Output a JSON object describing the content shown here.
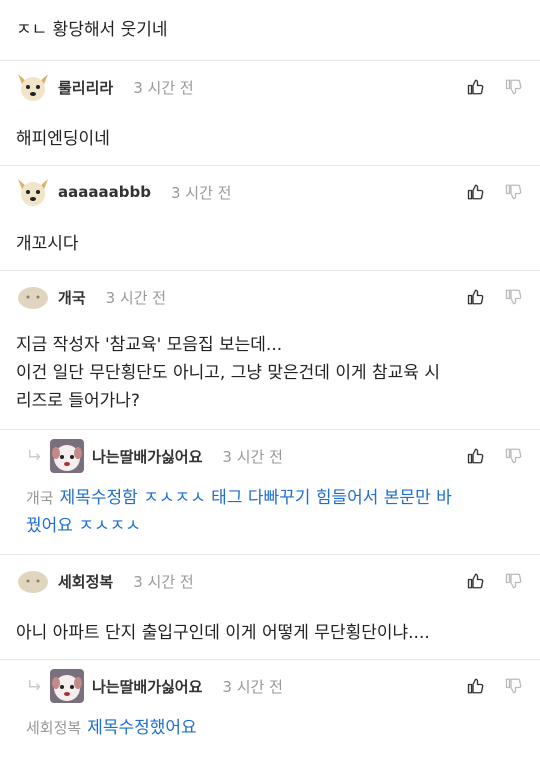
{
  "top_fragment": {
    "text": "ㅈㄴ 황당해서 웃기네"
  },
  "comments": [
    {
      "nick": "룰리리라",
      "time": "3 시간 전",
      "body": "해피엔딩이네"
    },
    {
      "nick": "aaaaaabbb",
      "time": "3 시간 전",
      "body": "개꼬시다"
    },
    {
      "nick": "개국",
      "time": "3 시간 전",
      "body_lines": [
        "지금 작성자 '참교육' 모음집 보는데...",
        "이건 일단 무단횡단도 아니고, 그냥 맞은건데 이게 참교육 시",
        "리즈로 들어가나?"
      ]
    },
    {
      "nick": "세회정복",
      "time": "3 시간 전",
      "body": "아니 아파트 단지 출입구인데 이게 어떻게 무단횡단이냐...."
    }
  ],
  "replies": [
    {
      "nick": "나는딸배가싫어요",
      "time": "3 시간 전",
      "mention": "개국",
      "body_lines": [
        "제목수정함 ㅈㅅㅈㅅ 태그 다빠꾸기 힘들어서 본문만 바",
        "꿨어요 ㅈㅅㅈㅅ"
      ]
    },
    {
      "nick": "나는딸배가싫어요",
      "time": "3 시간 전",
      "mention": "세회정복",
      "body": "제목수정했어요"
    }
  ],
  "colors": {
    "link": "#1e6fcf",
    "muted": "#999999",
    "separator": "#e6e6e6"
  },
  "icons": {
    "like": "thumbs-up-icon",
    "dislike": "thumbs-down-icon",
    "reply": "reply-arrow-icon"
  }
}
